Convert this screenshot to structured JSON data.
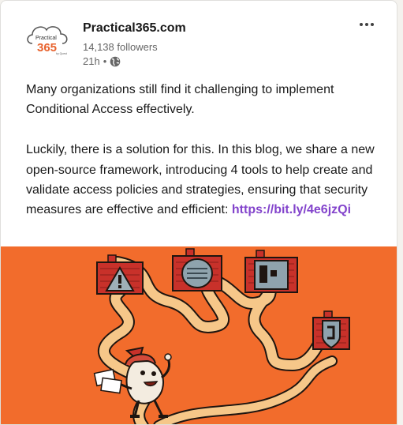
{
  "post": {
    "company_name": "Practical365.com",
    "followers": "14,138 followers",
    "time": "21h",
    "separator": "•",
    "paragraph1": "Many organizations still find it challenging to implement Conditional Access effectively.",
    "paragraph2": "Luckily, there is a solution for this. In this blog, we share a new open-source framework, introducing 4 tools to help create and validate access policies and strategies, ensuring that security measures are effective and efficient: ",
    "link": "https://bit.ly/4e6jzQi"
  },
  "logo": {
    "line1": "Practical",
    "line2": "365",
    "line3": "by Quest"
  },
  "icons": {
    "visibility": "globe-icon",
    "menu": "more-icon"
  },
  "colors": {
    "link": "#8344cc",
    "brand_orange": "#e8632e",
    "illustration_bg": "#f26c2c",
    "door_red": "#c8312a",
    "path": "#f6c789"
  }
}
